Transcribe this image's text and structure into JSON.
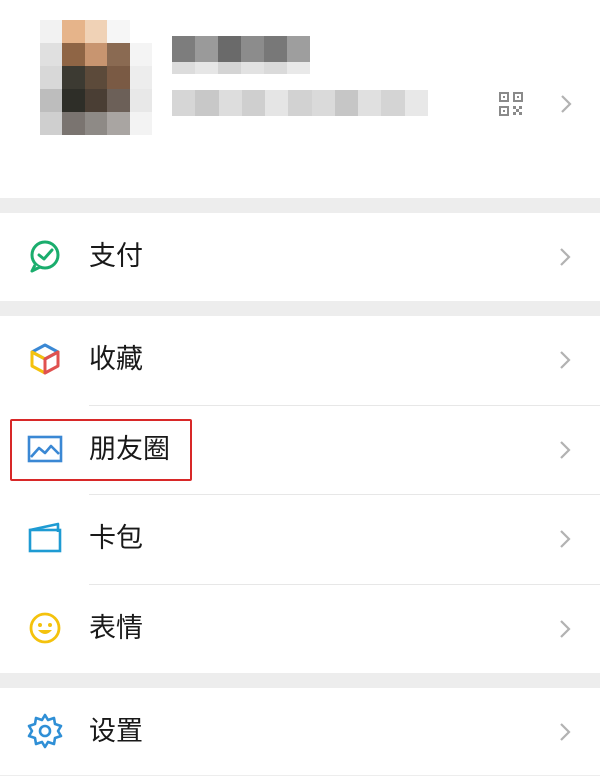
{
  "menu": {
    "pay": {
      "label": "支付",
      "icon": "wechat-pay-icon"
    },
    "favorites": {
      "label": "收藏",
      "icon": "favorites-cube-icon"
    },
    "moments": {
      "label": "朋友圈",
      "icon": "moments-picture-icon"
    },
    "cards": {
      "label": "卡包",
      "icon": "card-wallet-icon"
    },
    "stickers": {
      "label": "表情",
      "icon": "smiley-icon"
    },
    "settings": {
      "label": "设置",
      "icon": "gear-icon"
    }
  },
  "profile": {
    "qr_icon": "qr-code-icon",
    "chevron_icon": "chevron-right-icon"
  },
  "colors": {
    "highlight_border": "#d82828",
    "pay_green": "#1aad6d",
    "moments_blue": "#3a88d4",
    "cards_blue": "#1e9bd3",
    "settings_blue": "#2f8fd6",
    "smiley_yellow": "#f4c20d"
  }
}
